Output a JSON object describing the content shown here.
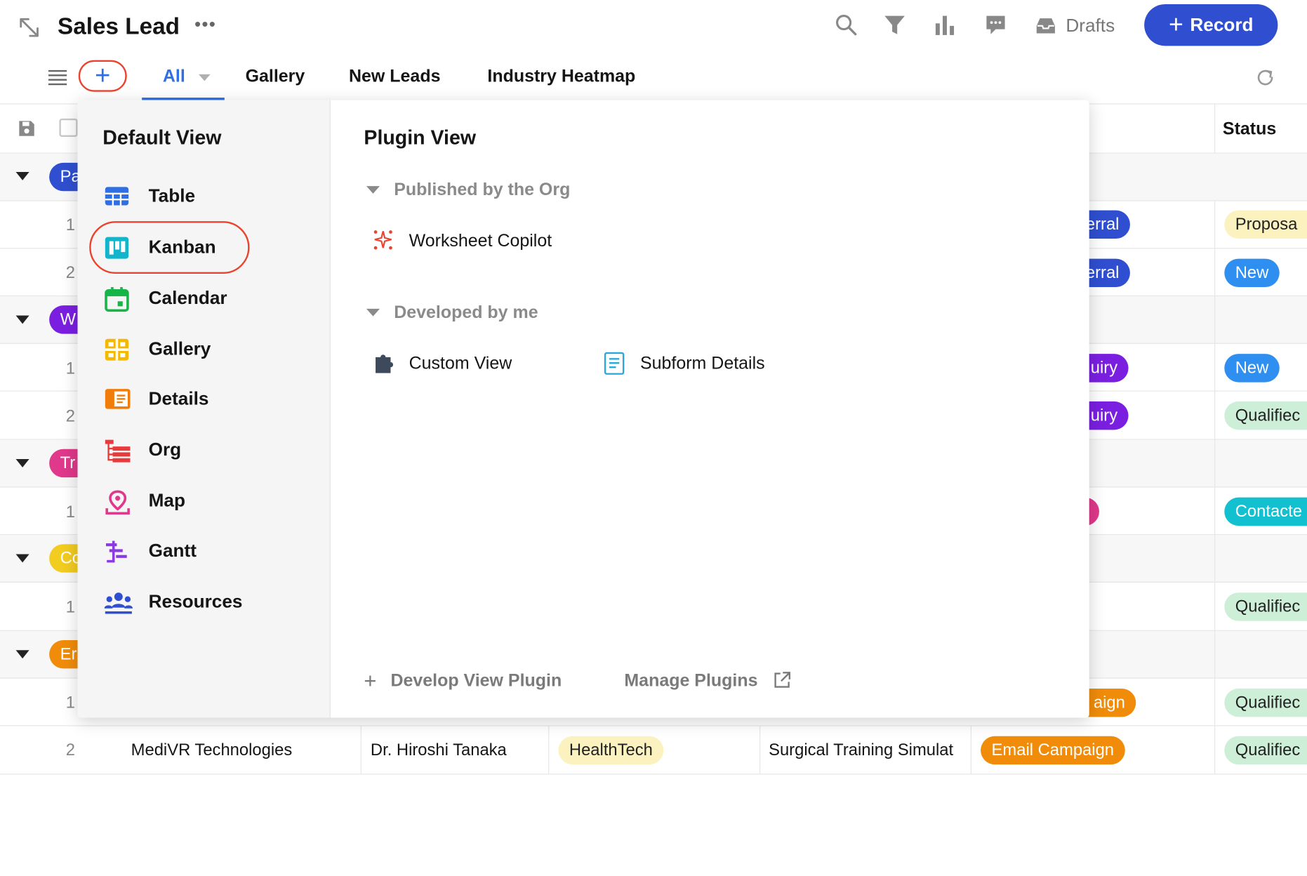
{
  "header": {
    "title": "Sales Lead",
    "more": "•••",
    "drafts_label": "Drafts",
    "record_label": "Record",
    "record_plus": "+",
    "accent": "#2f4fd0"
  },
  "tabs": {
    "add": "+",
    "items": [
      "All",
      "Gallery",
      "New Leads",
      "Industry Heatmap"
    ]
  },
  "grid": {
    "status_header": "Status",
    "groups": [
      {
        "label": "Pa",
        "color": "#2f4fd0"
      },
      {
        "label": "W",
        "color": "#7a1fe0"
      },
      {
        "label": "Tr",
        "color": "#e0388a"
      },
      {
        "label": "Co",
        "color": "#f2cc1f"
      },
      {
        "label": "Er",
        "color": "#f08c0a"
      }
    ],
    "row_numbers": [
      "1",
      "2",
      "1",
      "2",
      "1",
      "1",
      "1",
      "2"
    ],
    "source_partials": [
      "erral",
      "erral",
      "uiry",
      "uiry",
      "aign"
    ],
    "statuses": [
      "Proposa",
      "New",
      "New",
      "Qualifiec",
      "Contacte",
      "Qualifiec",
      "Qualifiec",
      "Qualifiec"
    ],
    "last_row": {
      "num": "2",
      "company": "MediVR Technologies",
      "contact": "Dr. Hiroshi Tanaka",
      "industry": "HealthTech",
      "need": "Surgical Training Simulat",
      "source": "Email Campaign",
      "status": "Qualifiec"
    }
  },
  "dropdown": {
    "default_title": "Default View",
    "views": [
      "Table",
      "Kanban",
      "Calendar",
      "Gallery",
      "Details",
      "Org",
      "Map",
      "Gantt",
      "Resources"
    ],
    "plugin_title": "Plugin View",
    "published_title": "Published by the Org",
    "published_items": [
      "Worksheet Copilot"
    ],
    "developed_title": "Developed by me",
    "developed_items": [
      "Custom View",
      "Subform Details"
    ],
    "develop_link": "Develop View Plugin",
    "develop_plus": "+",
    "manage_link": "Manage Plugins"
  }
}
